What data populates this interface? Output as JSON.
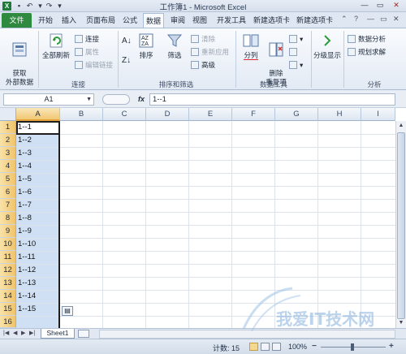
{
  "window": {
    "title": "工作簿1 - Microsoft Excel",
    "app_icon_letter": "X"
  },
  "ribbon_tabs": {
    "file": "文件",
    "items": [
      "开始",
      "插入",
      "页面布局",
      "公式",
      "数据",
      "审阅",
      "视图",
      "开发工具",
      "新建选项卡",
      "新建选项卡"
    ],
    "active": "数据"
  },
  "ribbon": {
    "get_external": "获取\n外部数据",
    "refresh_all": "全部刷新",
    "connections": "连接",
    "properties": "属性",
    "edit_links": "编辑链接",
    "group_connections": "连接",
    "sort": "排序",
    "filter": "筛选",
    "clear": "清除",
    "reapply": "重新应用",
    "advanced": "高级",
    "group_sort_filter": "排序和筛选",
    "text_to_columns": "分列",
    "remove_duplicates": "删除\n重复项",
    "group_data_tools": "数据工具",
    "outline": "分级显示",
    "data_analysis": "数据分析",
    "solver": "规划求解",
    "group_analysis": "分析"
  },
  "formula_bar": {
    "name_box": "A1",
    "fx": "fx",
    "content": "1--1"
  },
  "grid": {
    "columns": [
      "A",
      "B",
      "C",
      "D",
      "E",
      "F",
      "G",
      "H",
      "I"
    ],
    "rows": [
      "1",
      "2",
      "3",
      "4",
      "5",
      "6",
      "7",
      "8",
      "9",
      "10",
      "11",
      "12",
      "13",
      "14",
      "15",
      "16"
    ],
    "cells_A": [
      "1--1",
      "1--2",
      "1--3",
      "1--4",
      "1--5",
      "1--6",
      "1--7",
      "1--8",
      "1--9",
      "1--10",
      "1--11",
      "1--12",
      "1--13",
      "1--14",
      "1--15",
      ""
    ]
  },
  "sheet_tabs": {
    "sheet": "Sheet1"
  },
  "status": {
    "count": "计数: 15",
    "zoom": "100%",
    "minus": "−",
    "plus": "+"
  },
  "watermark": {
    "text": "我爱IT技术网"
  },
  "colors": {
    "file_tab": "#2d8a3e",
    "selection": "#cfe0f5",
    "header_selected": "#f1c774"
  }
}
